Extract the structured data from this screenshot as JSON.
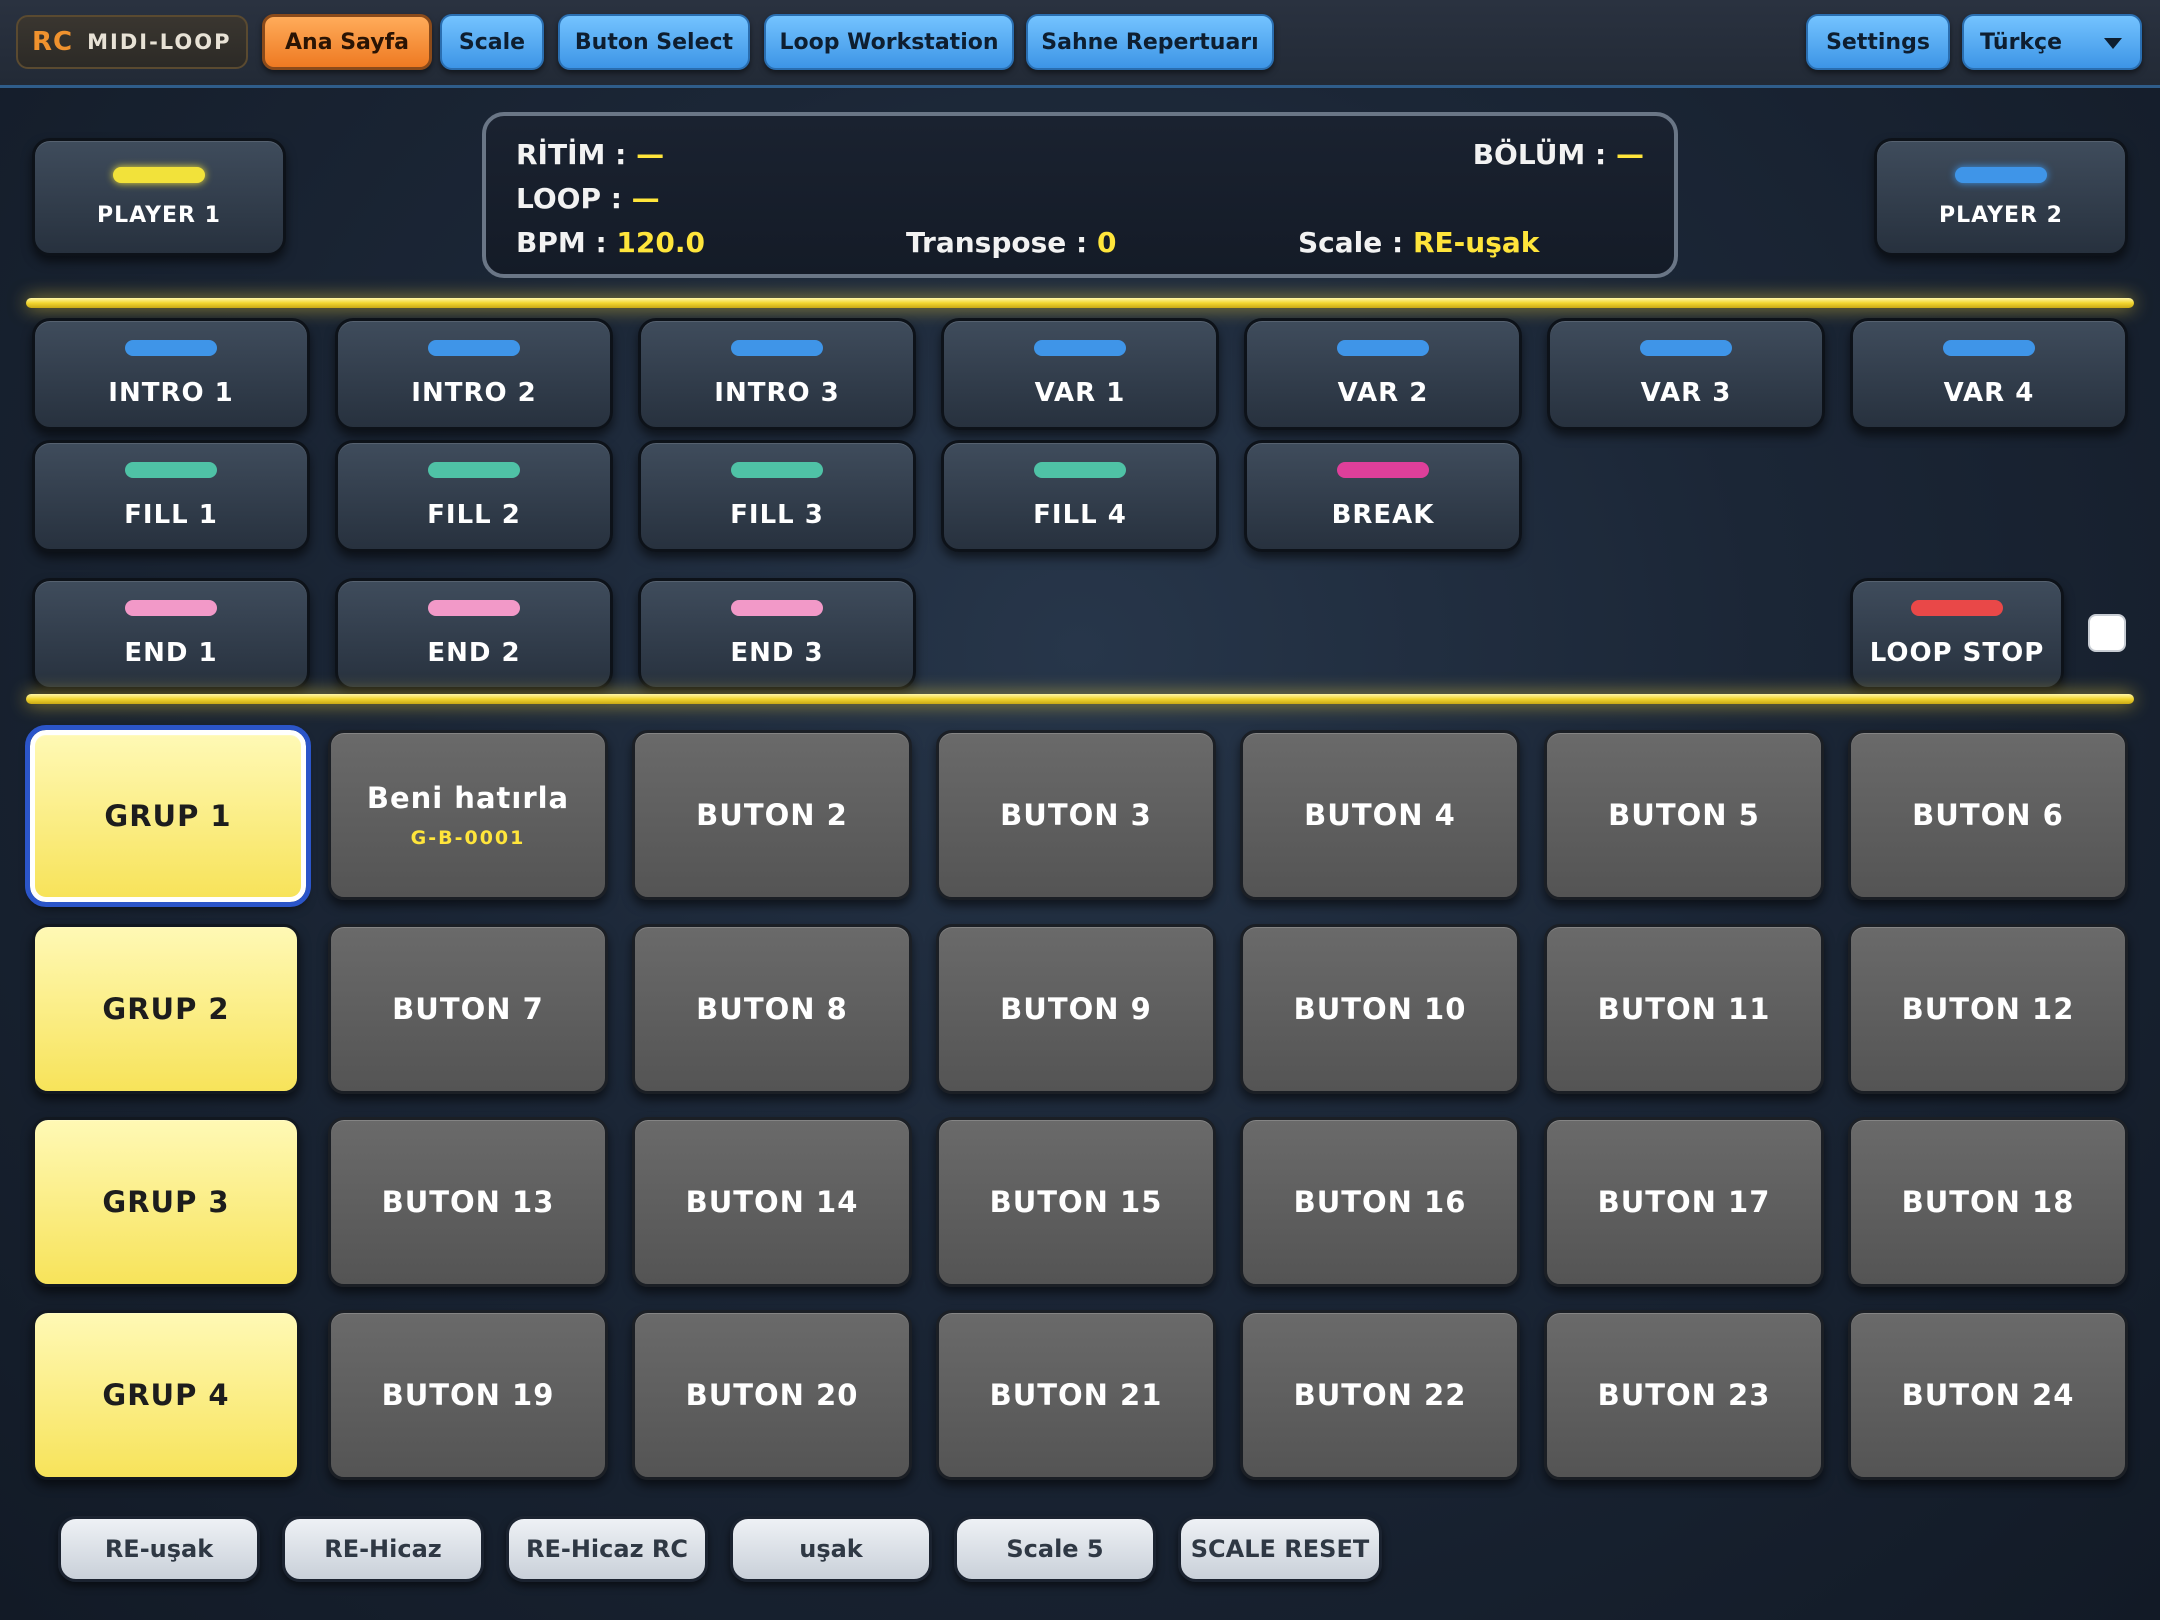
{
  "app": {
    "logo_rc": "RC",
    "logo_name": "MIDI-LOOP"
  },
  "nav": {
    "tabs": [
      "Ana Sayfa",
      "Scale",
      "Buton Select",
      "Loop Workstation",
      "Sahne Repertuarı"
    ],
    "active_tab": "Ana Sayfa",
    "settings": "Settings",
    "language": "Türkçe"
  },
  "players": [
    {
      "label": "PLAYER 1",
      "led_color": "#f2e23a"
    },
    {
      "label": "PLAYER 2",
      "led_color": "#3f95e8"
    }
  ],
  "status": {
    "ritim_label": "RİTİM :",
    "ritim_value": "—",
    "bolum_label": "BÖLÜM :",
    "bolum_value": "—",
    "loop_label": "LOOP :",
    "loop_value": "—",
    "bpm_label": "BPM :",
    "bpm_value": "120.0",
    "transpose_label": "Transpose :",
    "transpose_value": "0",
    "scale_label": "Scale :",
    "scale_value": "RE-uşak"
  },
  "patterns": {
    "row1": [
      {
        "label": "INTRO 1",
        "led": "#3f95e8"
      },
      {
        "label": "INTRO 2",
        "led": "#3f95e8"
      },
      {
        "label": "INTRO 3",
        "led": "#3f95e8"
      },
      {
        "label": "VAR 1",
        "led": "#3f95e8"
      },
      {
        "label": "VAR 2",
        "led": "#3f95e8"
      },
      {
        "label": "VAR 3",
        "led": "#3f95e8"
      },
      {
        "label": "VAR 4",
        "led": "#3f95e8"
      }
    ],
    "row2": [
      {
        "label": "FILL 1",
        "led": "#4fc2a6"
      },
      {
        "label": "FILL 2",
        "led": "#4fc2a6"
      },
      {
        "label": "FILL 3",
        "led": "#4fc2a6"
      },
      {
        "label": "FILL 4",
        "led": "#4fc2a6"
      },
      {
        "label": "BREAK",
        "led": "#de3f9a"
      }
    ],
    "row3": [
      {
        "label": "END 1",
        "led": "#f299c8"
      },
      {
        "label": "END 2",
        "led": "#f299c8"
      },
      {
        "label": "END 3",
        "led": "#f299c8"
      }
    ],
    "loop_stop": {
      "label": "LOOP STOP",
      "led": "#e94848"
    }
  },
  "grid": {
    "groups": [
      "GRUP 1",
      "GRUP 2",
      "GRUP 3",
      "GRUP 4"
    ],
    "selected_group": "GRUP 1",
    "buttons": [
      {
        "label": "Beni hatırla",
        "sub": "G-B-0001"
      },
      {
        "label": "BUTON 2"
      },
      {
        "label": "BUTON 3"
      },
      {
        "label": "BUTON 4"
      },
      {
        "label": "BUTON 5"
      },
      {
        "label": "BUTON 6"
      },
      {
        "label": "BUTON 7"
      },
      {
        "label": "BUTON 8"
      },
      {
        "label": "BUTON 9"
      },
      {
        "label": "BUTON 10"
      },
      {
        "label": "BUTON 11"
      },
      {
        "label": "BUTON 12"
      },
      {
        "label": "BUTON 13"
      },
      {
        "label": "BUTON 14"
      },
      {
        "label": "BUTON 15"
      },
      {
        "label": "BUTON 16"
      },
      {
        "label": "BUTON 17"
      },
      {
        "label": "BUTON 18"
      },
      {
        "label": "BUTON 19"
      },
      {
        "label": "BUTON 20"
      },
      {
        "label": "BUTON 21"
      },
      {
        "label": "BUTON 22"
      },
      {
        "label": "BUTON 23"
      },
      {
        "label": "BUTON 24"
      }
    ]
  },
  "scales": [
    "RE-uşak",
    "RE-Hicaz",
    "RE-Hicaz RC",
    "uşak",
    "Scale 5",
    "SCALE RESET"
  ]
}
